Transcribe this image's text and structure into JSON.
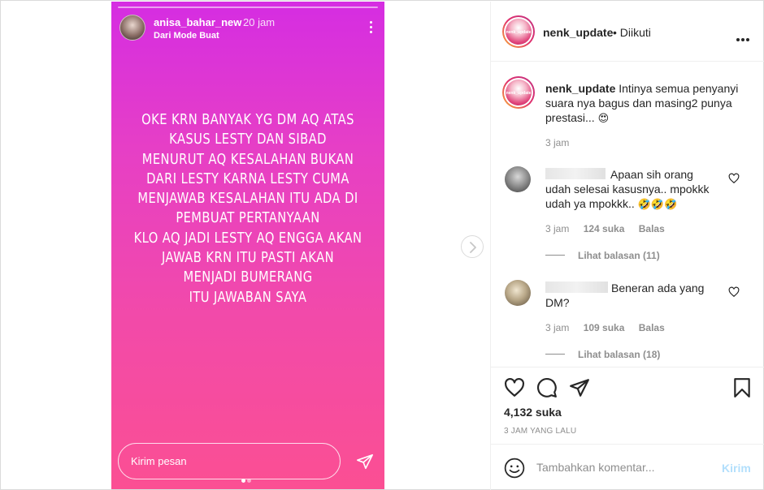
{
  "story": {
    "username": "anisa_bahar_new",
    "time": "20 jam",
    "mode": "Dari Mode Buat",
    "lines": [
      "OKE KRN BANYAK YG DM AQ ATAS",
      "KASUS LESTY DAN SIBAD",
      "MENURUT AQ KESALAHAN BUKAN",
      "DARI LESTY KARNA LESTY CUMA",
      "MENJAWAB KESALAHAN ITU ADA DI",
      "PEMBUAT PERTANYAAN",
      "KLO AQ JADI LESTY AQ ENGGA AKAN",
      "JAWAB KRN ITU PASTI AKAN",
      "MENJADI BUMERANG",
      "ITU JAWABAN SAYA"
    ],
    "reply_placeholder": "Kirim pesan"
  },
  "header": {
    "username": "nenk_update",
    "follow_status": "• Diikuti",
    "avatar_text": "nenk_update"
  },
  "caption": {
    "username": "nenk_update",
    "text": "Intinya semua penyanyi suara nya bagus dan masing2 punya prestasi...",
    "emoji": "😍",
    "time": "3 jam"
  },
  "comments": [
    {
      "text": "Apaan sih orang udah selesai kasusnya.. mpokkk udah ya mpokkk..",
      "emoji": "🤣🤣🤣",
      "time": "3 jam",
      "likes": "124 suka",
      "reply_label": "Balas",
      "view_replies": "Lihat balasan (11)"
    },
    {
      "text": "Beneran ada yang DM?",
      "emoji": "",
      "time": "3 jam",
      "likes": "109 suka",
      "reply_label": "Balas",
      "view_replies": "Lihat balasan (18)"
    }
  ],
  "post": {
    "likes": "4,132 suka",
    "time": "3 JAM YANG LALU"
  },
  "composer": {
    "placeholder": "Tambahkan komentar...",
    "post_label": "Kirim"
  },
  "icons": {
    "like": "heart-icon",
    "comment": "comment-icon",
    "share": "send-icon",
    "save": "bookmark-icon",
    "emoji": "emoji-icon",
    "more": "more-icon",
    "next": "chevron-right-icon"
  },
  "colors": {
    "story_gradient_top": "#d52de2",
    "story_gradient_bottom": "#fb4f93",
    "ring_orange": "#f9b234",
    "ring_pink": "#e1306c",
    "meta_gray": "#8e8e8e",
    "post_button_disabled": "#b2dffc"
  }
}
